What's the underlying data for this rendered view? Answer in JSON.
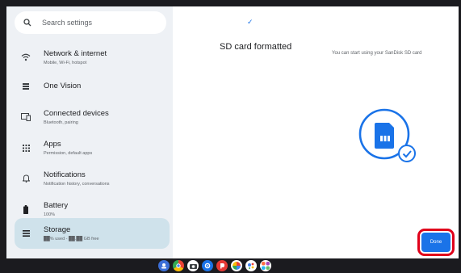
{
  "search": {
    "placeholder": "Search settings"
  },
  "sidebar": {
    "items": [
      {
        "title": "Network & internet",
        "sub": "Mobile, Wi-Fi, hotspot",
        "icon": "wifi-icon"
      },
      {
        "title": "One Vision",
        "sub": "",
        "icon": "grid-icon"
      },
      {
        "title": "Connected devices",
        "sub": "Bluetooth, pairing",
        "icon": "devices-icon"
      },
      {
        "title": "Apps",
        "sub": "Permission, default apps",
        "icon": "apps-icon"
      },
      {
        "title": "Notifications",
        "sub": "Notification history, conversations",
        "icon": "bell-icon"
      },
      {
        "title": "Battery",
        "sub": "100%",
        "icon": "battery-icon"
      },
      {
        "title": "Storage",
        "sub": "██% used - ██.██ GB free",
        "icon": "storage-icon"
      }
    ]
  },
  "main": {
    "check_glyph": "✓",
    "title": "SD card formatted",
    "description": "You can start using your SanDisk SD card",
    "done_label": "Done"
  },
  "colors": {
    "accent": "#1a73e8",
    "highlight": "#e0001a",
    "sidebar_bg": "#eef1f5",
    "active_bg": "#cfe2eb"
  },
  "taskbar": {
    "apps": [
      {
        "icon": "blue-app-icon",
        "color": "#3c6fd8"
      },
      {
        "icon": "chrome-icon",
        "color": "#e0a400"
      },
      {
        "icon": "camera-icon",
        "color": "#ffffff"
      },
      {
        "icon": "settings-icon",
        "color": "#1a73e8"
      },
      {
        "icon": "red-app-icon",
        "color": "#e53935"
      },
      {
        "icon": "photos-icon",
        "color": "#34a853"
      },
      {
        "icon": "assistant-icon",
        "color": "#4285f4"
      },
      {
        "icon": "colorful-app-icon",
        "color": "#ff7043"
      }
    ]
  }
}
